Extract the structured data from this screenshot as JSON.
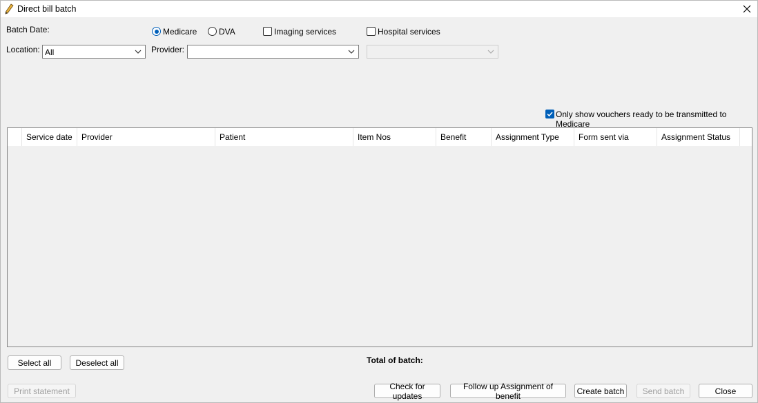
{
  "window": {
    "title": "Direct bill batch"
  },
  "filters": {
    "batch_date_label": "Batch Date:",
    "location_label": "Location:",
    "location_value": "All",
    "provider_label": "Provider:",
    "provider_value": "",
    "secondary_combo_value": "",
    "radio_medicare": "Medicare",
    "radio_dva": "DVA",
    "chk_imaging": "Imaging services",
    "chk_hospital": "Hospital services",
    "only_show_label": "Only show vouchers ready to be transmitted to Medicare"
  },
  "table": {
    "columns": [
      "Service date",
      "Provider",
      "Patient",
      "Item Nos",
      "Benefit",
      "Assignment Type",
      "Form sent via",
      "Assignment Status"
    ],
    "rows": []
  },
  "selection": {
    "select_all": "Select all",
    "deselect_all": "Deselect all"
  },
  "total_label": "Total of batch:",
  "footer": {
    "print_statement": "Print statement",
    "check_updates": "Check for updates",
    "follow_up": "Follow up Assignment of benefit",
    "create_batch": "Create batch",
    "send_batch": "Send batch",
    "close": "Close"
  },
  "colors": {
    "accent": "#005fb8",
    "background": "#f0f0f0"
  }
}
